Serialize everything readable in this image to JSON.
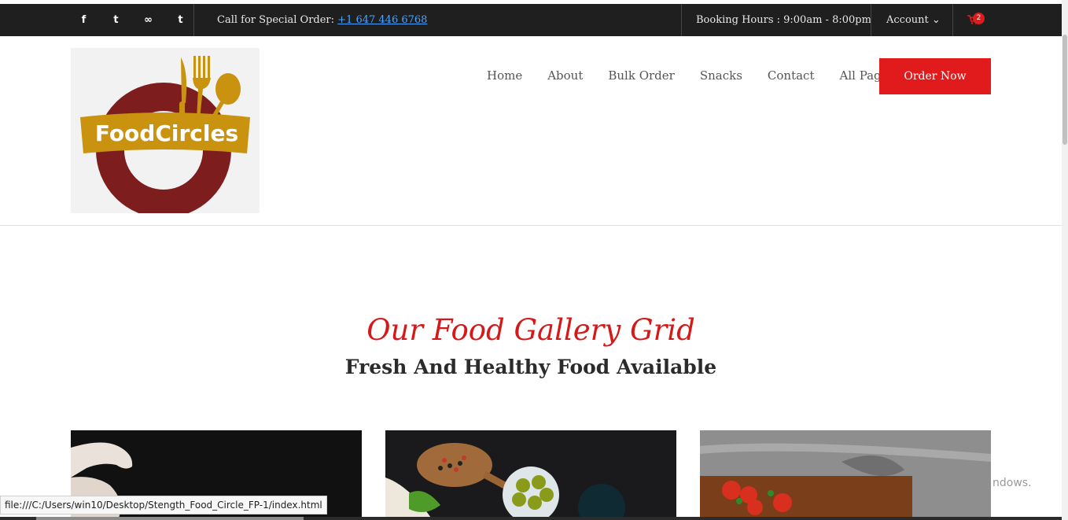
{
  "topbar": {
    "social_icons": [
      "facebook-icon",
      "twitter-icon",
      "tripadvisor-icon",
      "tumblr-icon"
    ],
    "social_glyphs": [
      "f",
      "t",
      "∞",
      "t"
    ],
    "call_label": "Call for Special Order:",
    "call_number": "+1 647 446 6768",
    "booking_hours": "Booking Hours : 9:00am - 8:00pm",
    "account_label": "Account ⌄",
    "cart_count": "2"
  },
  "logo": {
    "text": "FoodCircles"
  },
  "nav": {
    "items": [
      "Home",
      "About",
      "Bulk Order",
      "Snacks",
      "Contact",
      "All Pages"
    ],
    "cta": "Order Now"
  },
  "section": {
    "script_title": "Our Food Gallery Grid",
    "subtitle": "Fresh And Healthy Food Available"
  },
  "status_bar": {
    "url": "file:///C:/Users/win10/Desktop/Stength_Food_Circle_FP-1/index.html"
  },
  "watermark_text": "ndows.",
  "colors": {
    "accent": "#e11b1b",
    "topbar": "#1f1f1f",
    "logo_maroon": "#7d1d1d",
    "logo_gold": "#c9920f"
  }
}
